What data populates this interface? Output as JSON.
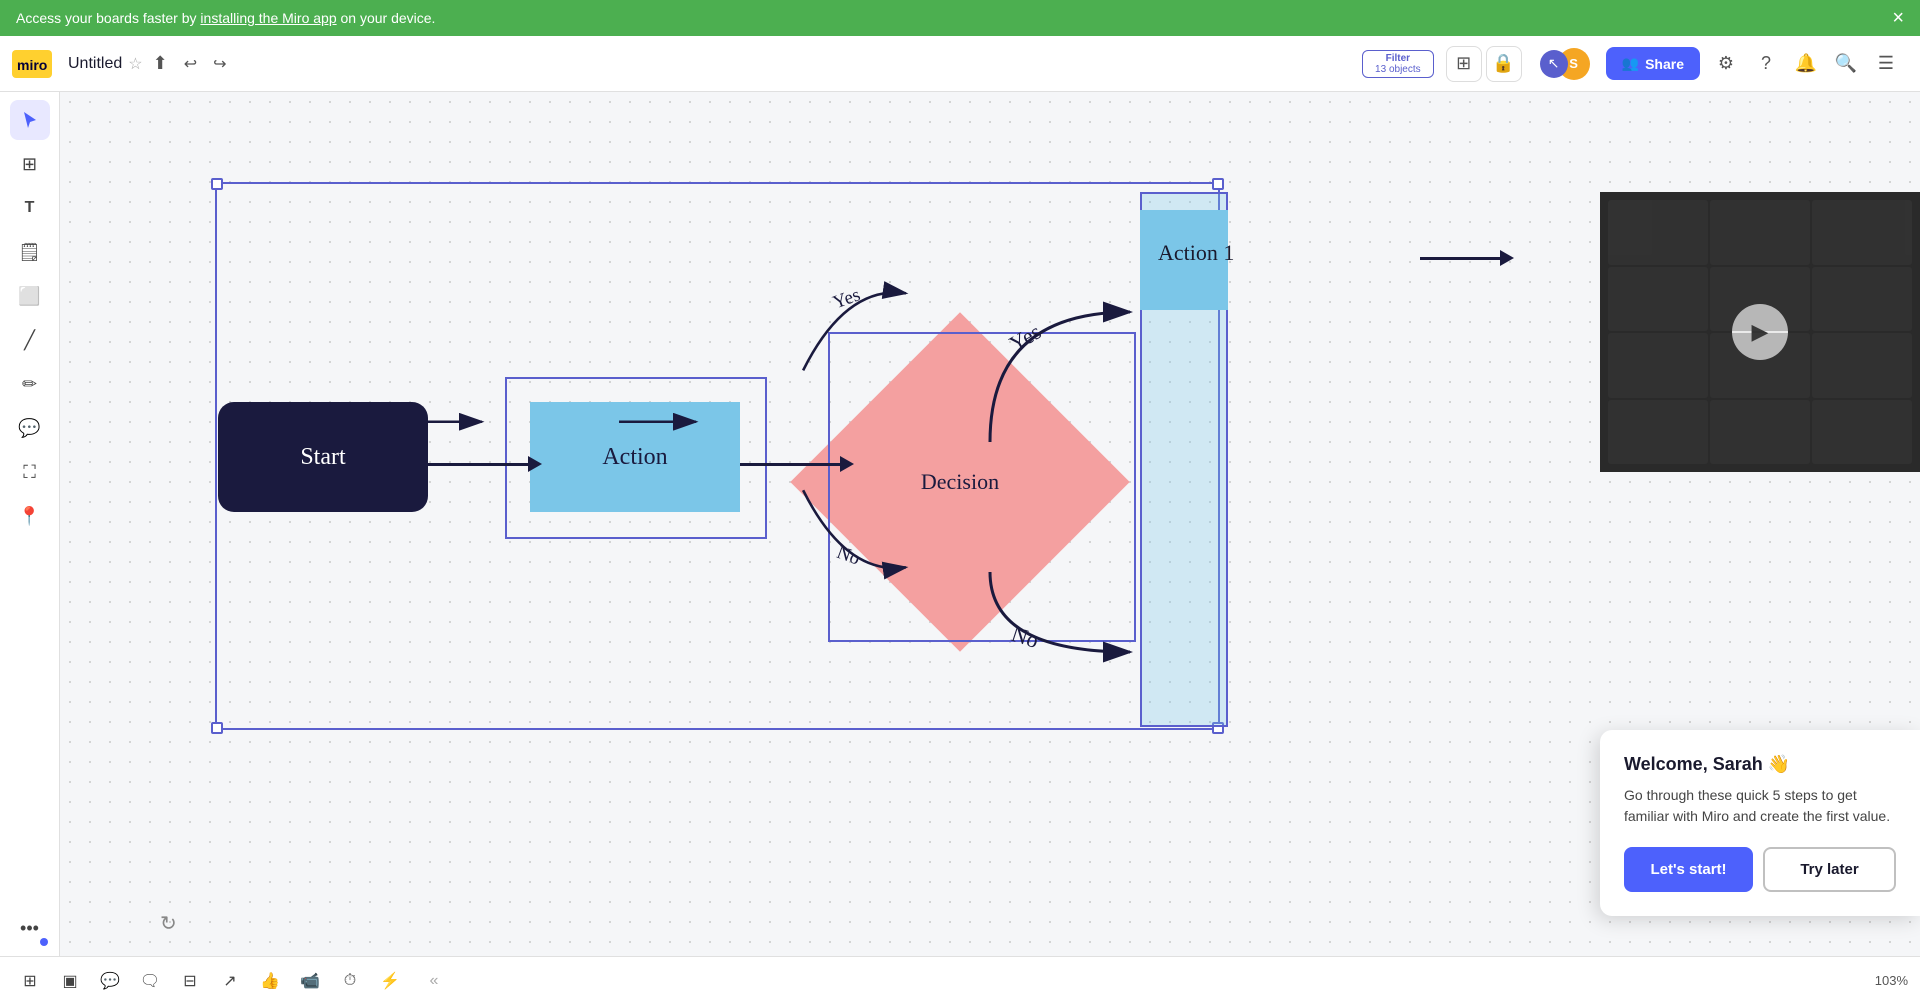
{
  "banner": {
    "text_before_link": "Access your boards faster by ",
    "link_text": "installing the Miro app",
    "text_after_link": " on your device.",
    "close_label": "×"
  },
  "header": {
    "board_title": "Untitled",
    "filter_label": "Filter",
    "filter_count": "13 objects",
    "share_label": "Share",
    "avatar_initials": "S",
    "undo_label": "↩",
    "redo_label": "↪"
  },
  "toolbar": {
    "tools": [
      "cursor",
      "grid",
      "text",
      "sticky",
      "frame",
      "line",
      "pencil",
      "comment",
      "crop",
      "pin",
      "more"
    ]
  },
  "flowchart": {
    "start_label": "Start",
    "action_label": "Action",
    "decision_label": "Decision",
    "action1_label": "Action 1",
    "yes_label": "Yes",
    "no_label": "No"
  },
  "welcome": {
    "title": "Welcome, Sarah 👋",
    "description": "Go through these quick 5 steps to get familiar with Miro and create the first value.",
    "start_label": "Let's start!",
    "later_label": "Try later"
  },
  "bottom_toolbar": {
    "zoom_level": "103%"
  }
}
